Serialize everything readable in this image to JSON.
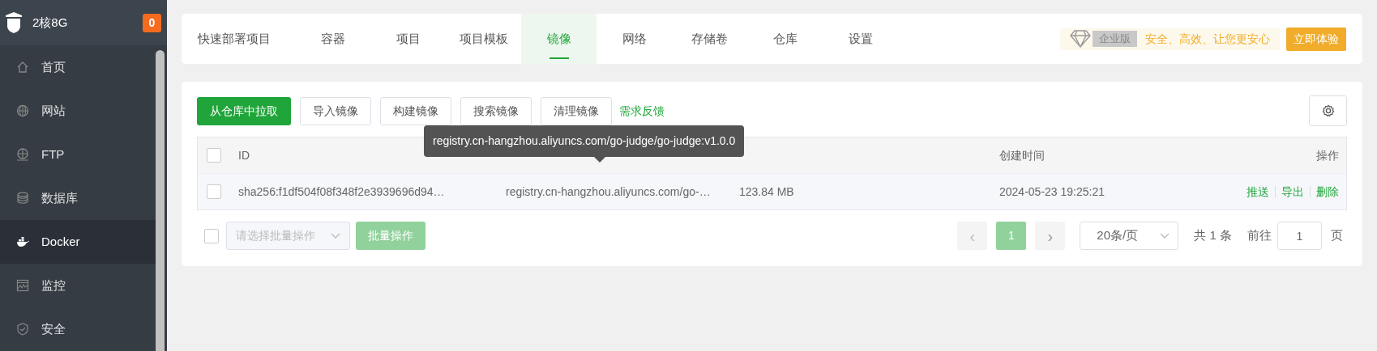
{
  "sidebar": {
    "server": "2核8G",
    "badge": "0",
    "items": [
      {
        "label": "首页",
        "kind": "home",
        "selected": false
      },
      {
        "label": "网站",
        "kind": "globe",
        "selected": false
      },
      {
        "label": "FTP",
        "kind": "ftp",
        "selected": false
      },
      {
        "label": "数据库",
        "kind": "database",
        "selected": false
      },
      {
        "label": "Docker",
        "kind": "docker",
        "selected": true
      },
      {
        "label": "监控",
        "kind": "monitor",
        "selected": false
      },
      {
        "label": "安全",
        "kind": "shield",
        "selected": false
      }
    ]
  },
  "tabs": [
    {
      "label": "快速部署项目",
      "selected": false
    },
    {
      "label": "容器",
      "selected": false
    },
    {
      "label": "项目",
      "selected": false
    },
    {
      "label": "项目模板",
      "selected": false
    },
    {
      "label": "镜像",
      "selected": true
    },
    {
      "label": "网络",
      "selected": false
    },
    {
      "label": "存储卷",
      "selected": false
    },
    {
      "label": "仓库",
      "selected": false
    },
    {
      "label": "设置",
      "selected": false
    }
  ],
  "promo": {
    "edition": "企业版",
    "slogan": "安全、高效、让您更安心",
    "button": "立即体验"
  },
  "toolbar": {
    "buttons": [
      {
        "label": "从仓库中拉取",
        "kind": "primary"
      },
      {
        "label": "导入镜像",
        "kind": "default"
      },
      {
        "label": "构建镜像",
        "kind": "default"
      },
      {
        "label": "搜索镜像",
        "kind": "default"
      },
      {
        "label": "清理镜像",
        "kind": "default"
      },
      {
        "label": "需求反馈",
        "kind": "link"
      }
    ]
  },
  "table": {
    "columns": {
      "id": "ID",
      "created": "创建时间",
      "actions": "操作"
    },
    "rows": [
      {
        "checked": false,
        "id": "sha256:f1df504f08f348f2e3939696d94…",
        "repository": "registry.cn-hangzhou.aliyuncs.com/go-…",
        "size": "123.84 MB",
        "created": "2024-05-23 19:25:21",
        "actions": [
          "推送",
          "导出",
          "删除"
        ]
      }
    ],
    "header_checked": false
  },
  "tooltip": "registry.cn-hangzhou.aliyuncs.com/go-judge/go-judge:v1.0.0",
  "batch": {
    "checked": false,
    "placeholder": "请选择批量操作",
    "button": "批量操作",
    "disabled": true
  },
  "pagination": {
    "prev": "‹",
    "pages": [
      {
        "label": "1",
        "selected": true
      }
    ],
    "next": "›",
    "page_size": "20条/页",
    "total": "共 1 条",
    "goto_label": "前往",
    "goto_value": "1",
    "goto_suffix": "页"
  }
}
